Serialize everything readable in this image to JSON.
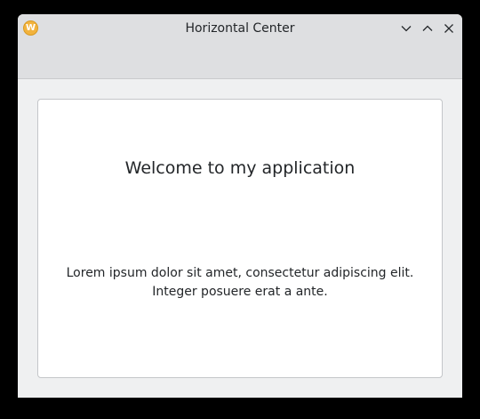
{
  "window": {
    "title": "Horizontal Center",
    "app_icon": {
      "name": "app-logo-icon",
      "glyph": "W",
      "color": "#f2b33d"
    },
    "controls": {
      "minimize_icon": "chevron-down-icon",
      "maximize_icon": "chevron-up-icon",
      "close_icon": "close-icon"
    }
  },
  "main": {
    "heading": "Welcome to my application",
    "body_line1": "Lorem ipsum dolor sit amet, consectetur adipiscing elit.",
    "body_line2": "Integer posuere erat a ante."
  },
  "colors": {
    "titlebar_bg": "#dedfe1",
    "window_bg": "#eff0f1",
    "card_bg": "#ffffff",
    "text": "#232629"
  }
}
